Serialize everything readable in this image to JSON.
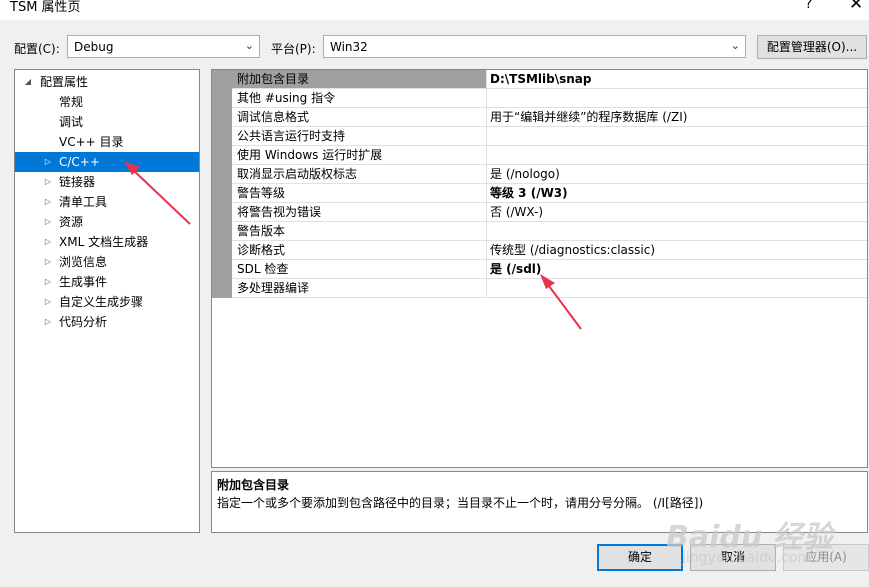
{
  "window": {
    "title": "TSM 属性页",
    "help_glyph": "?",
    "close_glyph": "✕"
  },
  "config_bar": {
    "config_label": "配置(C):",
    "config_value": "Debug",
    "platform_label": "平台(P):",
    "platform_value": "Win32",
    "config_manager_label": "配置管理器(O)..."
  },
  "tree": {
    "root": "配置属性",
    "items": [
      {
        "label": "常规",
        "expandable": false,
        "selected": false
      },
      {
        "label": "调试",
        "expandable": false,
        "selected": false
      },
      {
        "label": "VC++ 目录",
        "expandable": false,
        "selected": false
      },
      {
        "label": "C/C++",
        "expandable": true,
        "selected": true
      },
      {
        "label": "链接器",
        "expandable": true,
        "selected": false
      },
      {
        "label": "清单工具",
        "expandable": true,
        "selected": false
      },
      {
        "label": "资源",
        "expandable": true,
        "selected": false
      },
      {
        "label": "XML 文档生成器",
        "expandable": true,
        "selected": false
      },
      {
        "label": "浏览信息",
        "expandable": true,
        "selected": false
      },
      {
        "label": "生成事件",
        "expandable": true,
        "selected": false
      },
      {
        "label": "自定义生成步骤",
        "expandable": true,
        "selected": false
      },
      {
        "label": "代码分析",
        "expandable": true,
        "selected": false
      }
    ]
  },
  "properties": [
    {
      "name": "附加包含目录",
      "value": "D:\\TSMlib\\snap",
      "bold": true,
      "selected": true
    },
    {
      "name": "其他 #using 指令",
      "value": "",
      "bold": false,
      "selected": false
    },
    {
      "name": "调试信息格式",
      "value": "用于“编辑并继续”的程序数据库 (/ZI)",
      "bold": false,
      "selected": false
    },
    {
      "name": "公共语言运行时支持",
      "value": "",
      "bold": false,
      "selected": false
    },
    {
      "name": "使用 Windows 运行时扩展",
      "value": "",
      "bold": false,
      "selected": false
    },
    {
      "name": "取消显示启动版权标志",
      "value": "是 (/nologo)",
      "bold": false,
      "selected": false
    },
    {
      "name": "警告等级",
      "value": "等级 3 (/W3)",
      "bold": true,
      "selected": false
    },
    {
      "name": "将警告视为错误",
      "value": "否 (/WX-)",
      "bold": false,
      "selected": false
    },
    {
      "name": "警告版本",
      "value": "",
      "bold": false,
      "selected": false
    },
    {
      "name": "诊断格式",
      "value": "传统型 (/diagnostics:classic)",
      "bold": false,
      "selected": false
    },
    {
      "name": "SDL 检查",
      "value": "是 (/sdl)",
      "bold": true,
      "selected": false
    },
    {
      "name": "多处理器编译",
      "value": "",
      "bold": false,
      "selected": false
    }
  ],
  "description": {
    "title": "附加包含目录",
    "text": "指定一个或多个要添加到包含路径中的目录；当目录不止一个时，请用分号分隔。     (/I[路径])"
  },
  "buttons": {
    "ok": "确定",
    "cancel": "取消",
    "apply": "应用(A)"
  },
  "watermark": {
    "line1": "Baidu 经验",
    "line2": "jingyan.baidu.com"
  },
  "colors": {
    "selection": "#0078d7",
    "annotation_arrow": "#e8344a",
    "gutter": "#a0a0a0"
  }
}
